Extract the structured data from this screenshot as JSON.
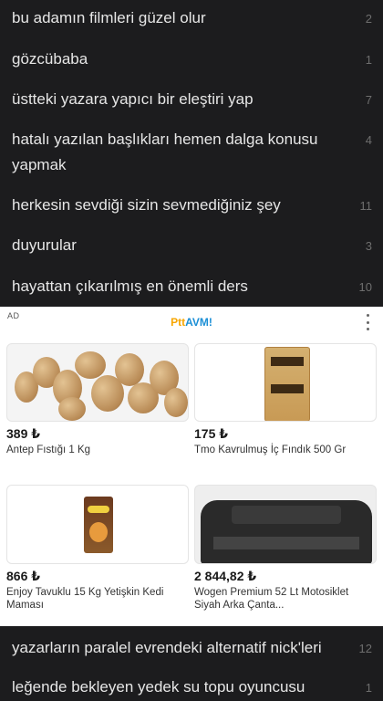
{
  "topics_top": [
    {
      "title": "bu adamın filmleri güzel olur",
      "count": "2"
    },
    {
      "title": "gözcübaba",
      "count": "1"
    },
    {
      "title": "üstteki yazara yapıcı bir eleştiri yap",
      "count": "7"
    },
    {
      "title": "hatalı yazılan başlıkları hemen dalga konusu yapmak",
      "count": "4"
    },
    {
      "title": "herkesin sevdiği sizin sevmediğiniz şey",
      "count": "11"
    },
    {
      "title": "duyurular",
      "count": "3"
    },
    {
      "title": "hayattan çıkarılmış en önemli ders",
      "count": "10"
    }
  ],
  "ad": {
    "label": "AD",
    "brand_ptt": "Ptt",
    "brand_avm": "AVM!",
    "products": [
      {
        "price": "389 ₺",
        "name": "Antep Fıstığı 1 Kg"
      },
      {
        "price": "175 ₺",
        "name": "Tmo Kavrulmuş İç Fındık 500 Gr"
      },
      {
        "price": "866 ₺",
        "name": "Enjoy Tavuklu 15 Kg Yetişkin Kedi Maması"
      },
      {
        "price": "2 844,82 ₺",
        "name": "Wogen Premium 52 Lt Motosiklet Siyah Arka Çanta..."
      }
    ]
  },
  "topics_bottom": [
    {
      "title": "yazarların paralel evrendeki alternatif nick'leri",
      "count": "12"
    },
    {
      "title": "leğende bekleyen yedek su topu oyuncusu",
      "count": "1"
    }
  ],
  "colors": {
    "background": "#1c1c1e",
    "text": "#e6e6e6",
    "count": "#6e6e6e"
  }
}
